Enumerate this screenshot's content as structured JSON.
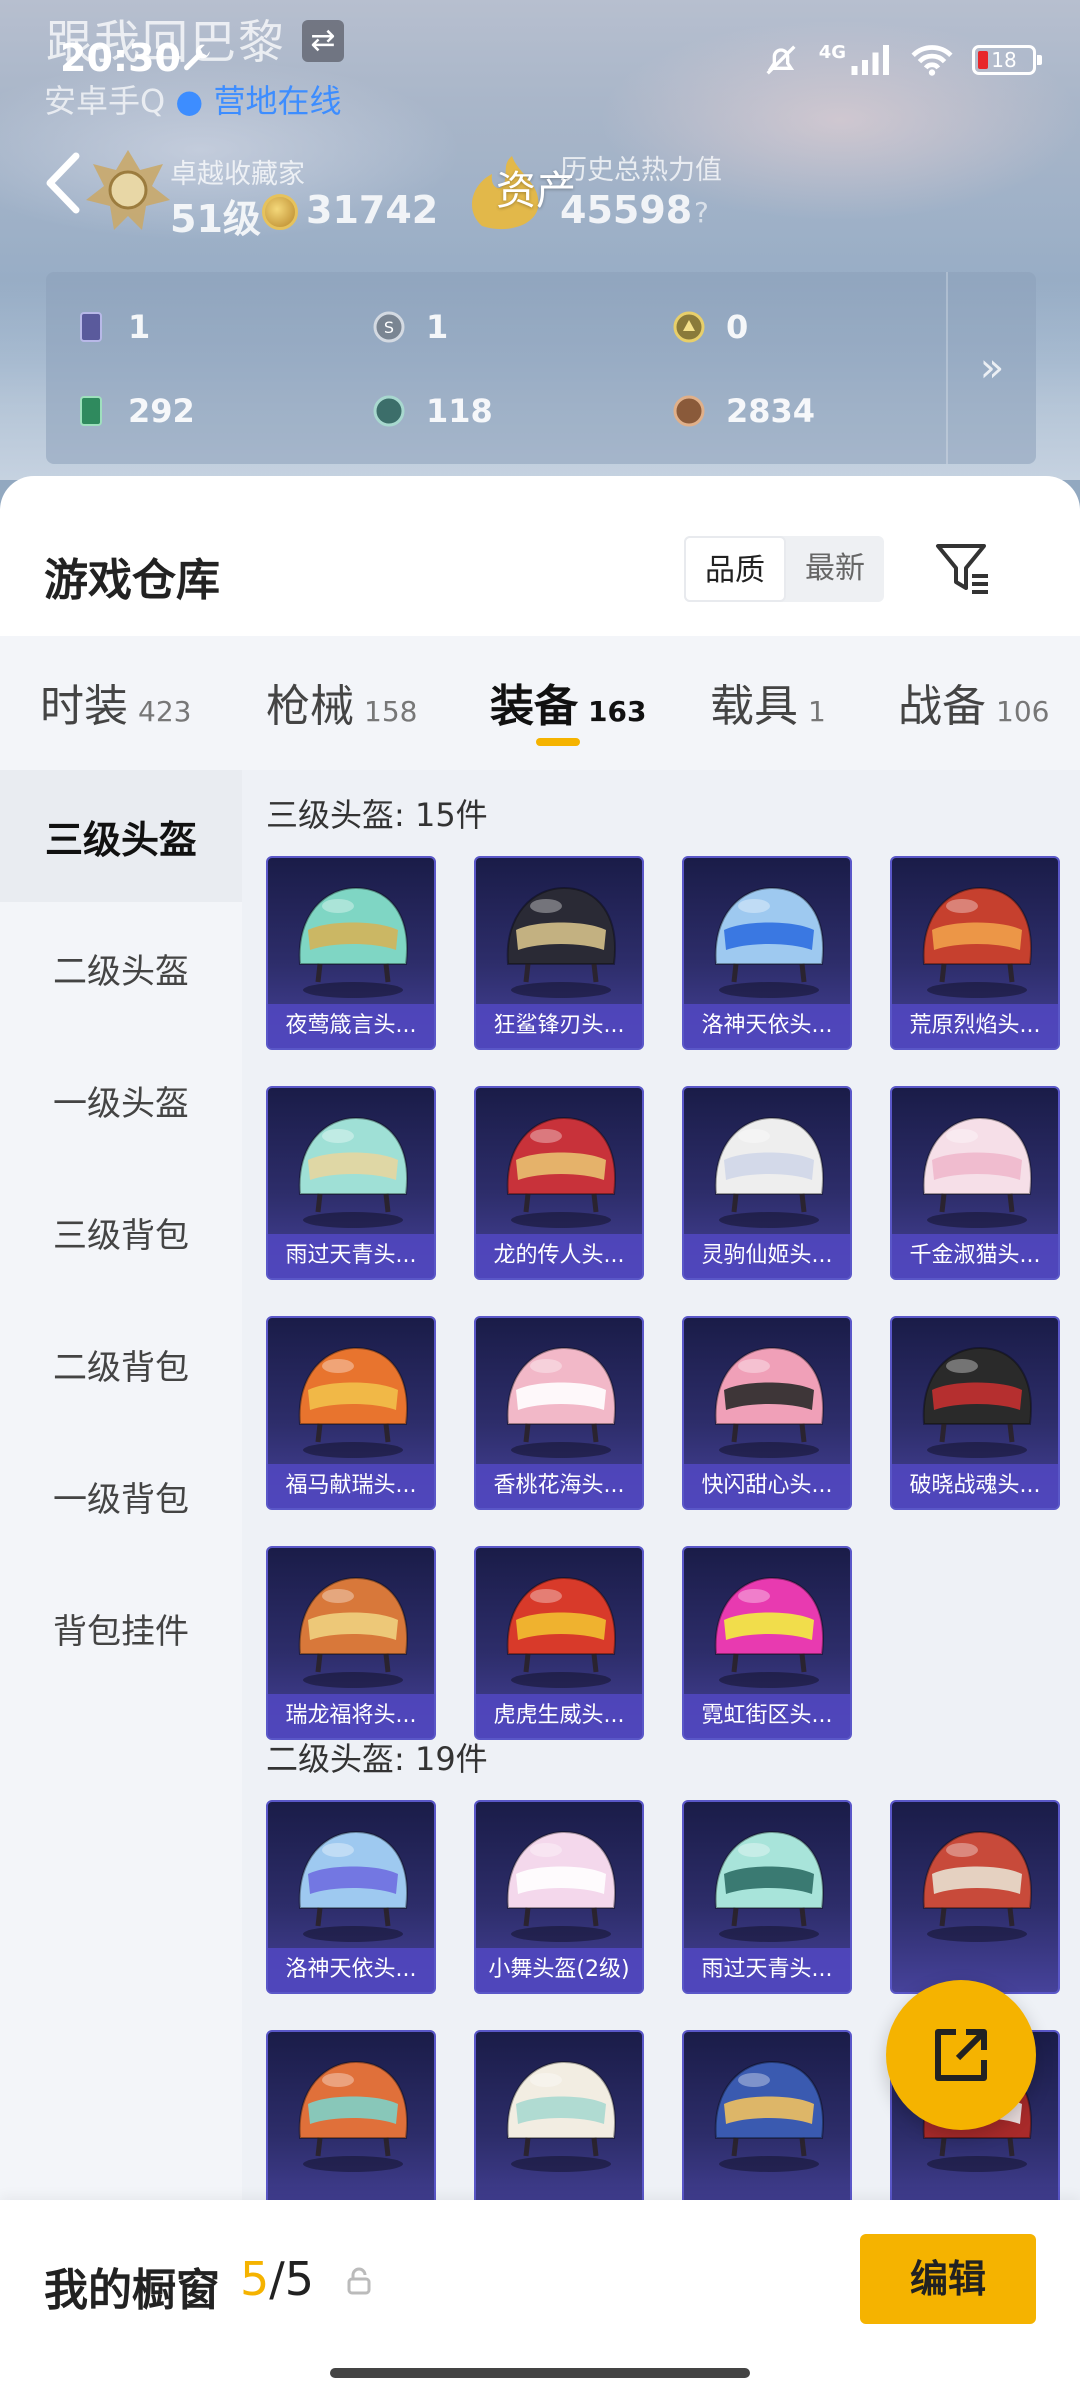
{
  "status_bar": {
    "song_title": "跟我回巴黎",
    "time": "20:30",
    "sub_status_prefix": "安卓手Q",
    "sub_status_online": "营地在线",
    "network": "4G",
    "battery": "18"
  },
  "profile": {
    "rank_title": "卓越收藏家",
    "level": "51级",
    "coins": "31742",
    "asset_label": "资产",
    "heat_label": "历史总热力值",
    "heat_value": "45598",
    "help": "?"
  },
  "stats": [
    {
      "icon": "card-icon",
      "value": "1"
    },
    {
      "icon": "silver-s-icon",
      "value": "1"
    },
    {
      "icon": "gold-coin-icon",
      "value": "0"
    },
    {
      "icon": "green-card-icon",
      "value": "292"
    },
    {
      "icon": "teal-orb-icon",
      "value": "118"
    },
    {
      "icon": "bronze-orb-icon",
      "value": "2834"
    }
  ],
  "stats_more": "»",
  "warehouse": {
    "title": "游戏仓库",
    "sort_options": [
      "品质",
      "最新"
    ],
    "sort_selected": "品质"
  },
  "category_tabs": [
    {
      "label": "时装",
      "count": "423"
    },
    {
      "label": "枪械",
      "count": "158"
    },
    {
      "label": "装备",
      "count": "163",
      "active": true
    },
    {
      "label": "载具",
      "count": "1"
    },
    {
      "label": "战备",
      "count": "106"
    }
  ],
  "side_nav": [
    "三级头盔",
    "二级头盔",
    "一级头盔",
    "三级背包",
    "二级背包",
    "一级背包",
    "背包挂件"
  ],
  "side_nav_selected": "三级头盔",
  "sections": [
    {
      "title": "三级头盔: 15件",
      "items": [
        {
          "name": "夜莺箴言头...",
          "color": "#7fd6c4",
          "accent": "#d4b45a"
        },
        {
          "name": "狂鲨锋刃头...",
          "color": "#2a2a35",
          "accent": "#d4c08a"
        },
        {
          "name": "洛神天依头...",
          "color": "#9ec9f0",
          "accent": "#2f6fe0"
        },
        {
          "name": "荒原烈焰头...",
          "color": "#c6402e",
          "accent": "#f0a04a"
        },
        {
          "name": "雨过天青头...",
          "color": "#9fe0d6",
          "accent": "#e6d6a0"
        },
        {
          "name": "龙的传人头...",
          "color": "#c8323a",
          "accent": "#e8c070"
        },
        {
          "name": "灵驹仙姬头...",
          "color": "#eeeeee",
          "accent": "#cfd6e8"
        },
        {
          "name": "千金淑猫头...",
          "color": "#f6dfe8",
          "accent": "#f0b8cc"
        },
        {
          "name": "福马献瑞头...",
          "color": "#e8742e",
          "accent": "#f2c04a"
        },
        {
          "name": "香桃花海头...",
          "color": "#f2b8c8",
          "accent": "#ffffff"
        },
        {
          "name": "快闪甜心头...",
          "color": "#f0a0b8",
          "accent": "#2a2a2a"
        },
        {
          "name": "破晓战魂头...",
          "color": "#2a2a2a",
          "accent": "#c43030"
        },
        {
          "name": "瑞龙福将头...",
          "color": "#d8783a",
          "accent": "#f0d080"
        },
        {
          "name": "虎虎生威头...",
          "color": "#d83a2a",
          "accent": "#f2c030"
        },
        {
          "name": "霓虹街区头...",
          "color": "#e83ab0",
          "accent": "#f2f040"
        }
      ]
    },
    {
      "title": "二级头盔: 19件",
      "items": [
        {
          "name": "洛神天依头...",
          "color": "#9ec9f0",
          "accent": "#6e6ee0"
        },
        {
          "name": "小舞头盔(2级)",
          "color": "#f4d8ec",
          "accent": "#ffffff"
        },
        {
          "name": "雨过天青头...",
          "color": "#a8e4da",
          "accent": "#2e6e66"
        },
        {
          "name": "",
          "color": "#c84a3a",
          "accent": "#e8e0d0"
        },
        {
          "name": "",
          "color": "#e0703a",
          "accent": "#7ed0c8"
        },
        {
          "name": "",
          "color": "#f2ede2",
          "accent": "#a8d8d0"
        },
        {
          "name": "",
          "color": "#3a5ab0",
          "accent": "#f0c060"
        },
        {
          "name": "",
          "color": "#a82a2a",
          "accent": "#f0f0f0"
        }
      ]
    }
  ],
  "showcase": {
    "label": "我的橱窗",
    "current": "5",
    "total": "/5",
    "edit": "编辑"
  },
  "colors": {
    "accent": "#f5b300",
    "card_bg": "#2d2d6a",
    "card_label": "#5046be"
  }
}
